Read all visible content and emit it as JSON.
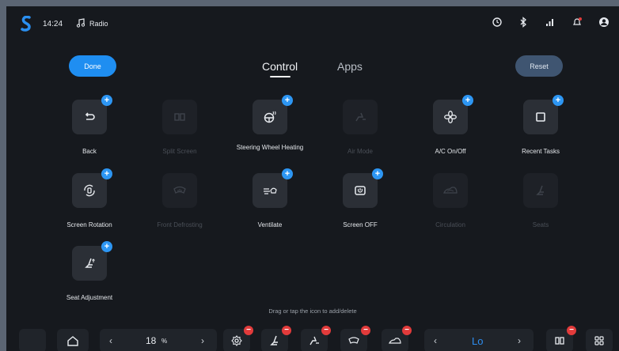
{
  "status": {
    "time": "14:24",
    "media": "Radio"
  },
  "header": {
    "done_label": "Done",
    "reset_label": "Reset",
    "tabs": [
      "Control",
      "Apps"
    ],
    "active_tab": "Control"
  },
  "tiles": [
    {
      "label": "Back",
      "icon": "back-arrow-icon",
      "active": true
    },
    {
      "label": "Split Screen",
      "icon": "split-screen-icon",
      "active": false
    },
    {
      "label": "Steering Wheel Heating",
      "icon": "steering-wheel-heat-icon",
      "active": true
    },
    {
      "label": "Air Mode",
      "icon": "air-mode-icon",
      "active": false
    },
    {
      "label": "A/C On/Off",
      "icon": "fan-icon",
      "active": true
    },
    {
      "label": "Recent Tasks",
      "icon": "square-icon",
      "active": true
    },
    {
      "label": "Screen Rotation",
      "icon": "screen-rotation-icon",
      "active": true
    },
    {
      "label": "Front Defrosting",
      "icon": "front-defrost-icon",
      "active": false
    },
    {
      "label": "Ventilate",
      "icon": "ventilate-icon",
      "active": true
    },
    {
      "label": "Screen OFF",
      "icon": "screen-off-icon",
      "active": true
    },
    {
      "label": "Circulation",
      "icon": "circulation-icon",
      "active": false
    },
    {
      "label": "Seats",
      "icon": "seat-icon",
      "active": false
    },
    {
      "label": "Seat Adjustment",
      "icon": "seat-adjust-icon",
      "active": true
    }
  ],
  "hint": "Drag or tap the icon to add/delete",
  "dock": {
    "volume_value": "18",
    "volume_unit": "%",
    "temp_value": "Lo",
    "items": [
      "home-icon",
      "gear-icon",
      "seat-heat-icon",
      "air-mode-icon",
      "front-defrost-icon",
      "car-icon",
      "split-screen-icon",
      "grid-icon"
    ]
  },
  "colors": {
    "accent": "#1f8ef1",
    "remove": "#e23b3b",
    "background": "#16191e"
  }
}
